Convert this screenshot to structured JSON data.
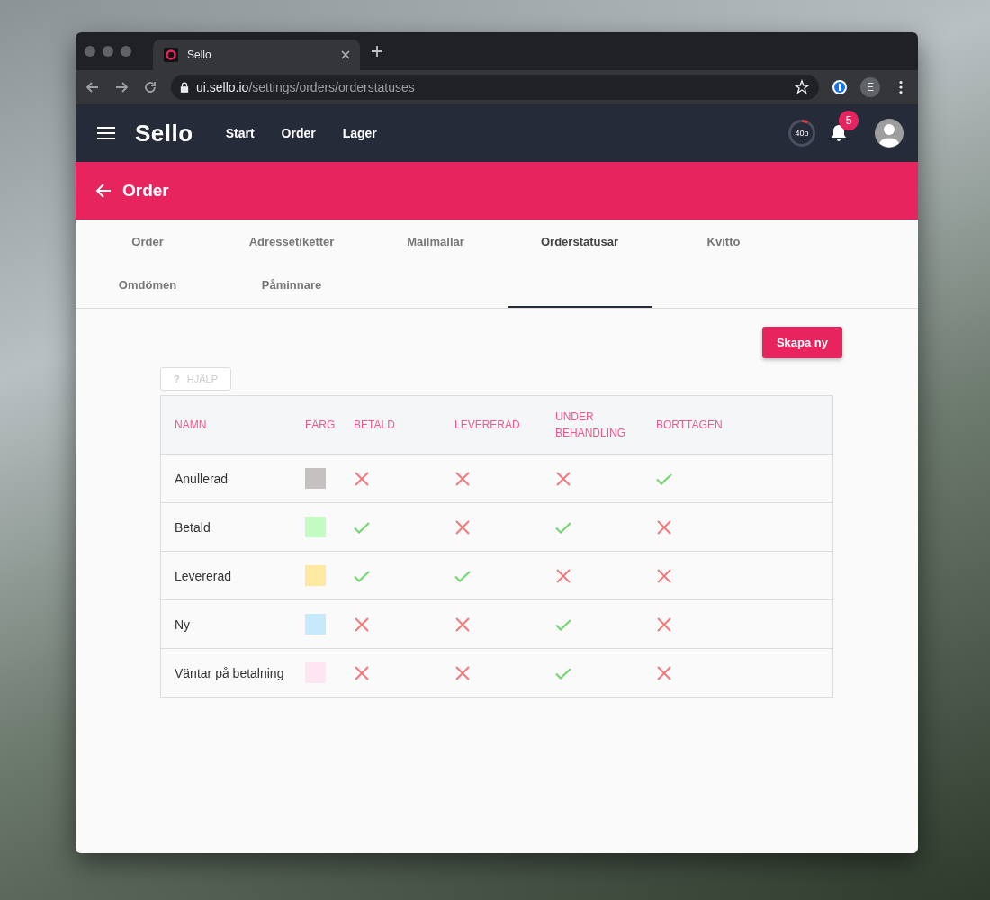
{
  "browser": {
    "tab_title": "Sello",
    "url_host": "ui.sello.io",
    "url_path": "/settings/orders/orderstatuses",
    "profile_initial": "E"
  },
  "app_bar": {
    "logo": "Sello",
    "nav": [
      "Start",
      "Order",
      "Lager"
    ],
    "timer": "40p",
    "notification_count": "5"
  },
  "page_header": {
    "title": "Order"
  },
  "tabs": [
    {
      "label": "Order",
      "selected": false
    },
    {
      "label": "Adressetiketter",
      "selected": false
    },
    {
      "label": "Mailmallar",
      "selected": false
    },
    {
      "label": "Orderstatusar",
      "selected": true
    },
    {
      "label": "Kvitto",
      "selected": false
    },
    {
      "label": "Omdömen",
      "selected": false
    },
    {
      "label": "Påminnare",
      "selected": false
    }
  ],
  "create_button": "Skapa ny",
  "help_button": {
    "icon": "?",
    "label": "HJÄLP",
    "disabled": true
  },
  "table": {
    "columns": [
      "NAMN",
      "FÄRG",
      "BETALD",
      "LEVERERAD",
      "UNDER BEHANDLING",
      "BORTTAGEN"
    ],
    "rows": [
      {
        "name": "Anullerad",
        "color": "#c5c1c1",
        "flags": [
          false,
          false,
          false,
          true
        ]
      },
      {
        "name": "Betald",
        "color": "#c3fcc3",
        "flags": [
          true,
          false,
          true,
          false
        ]
      },
      {
        "name": "Levererad",
        "color": "#fde99f",
        "flags": [
          true,
          true,
          false,
          false
        ]
      },
      {
        "name": "Ny",
        "color": "#c7e9fc",
        "flags": [
          false,
          false,
          true,
          false
        ]
      },
      {
        "name": "Väntar på betalning",
        "color": "#fde6f1",
        "flags": [
          false,
          false,
          true,
          false
        ]
      }
    ]
  }
}
